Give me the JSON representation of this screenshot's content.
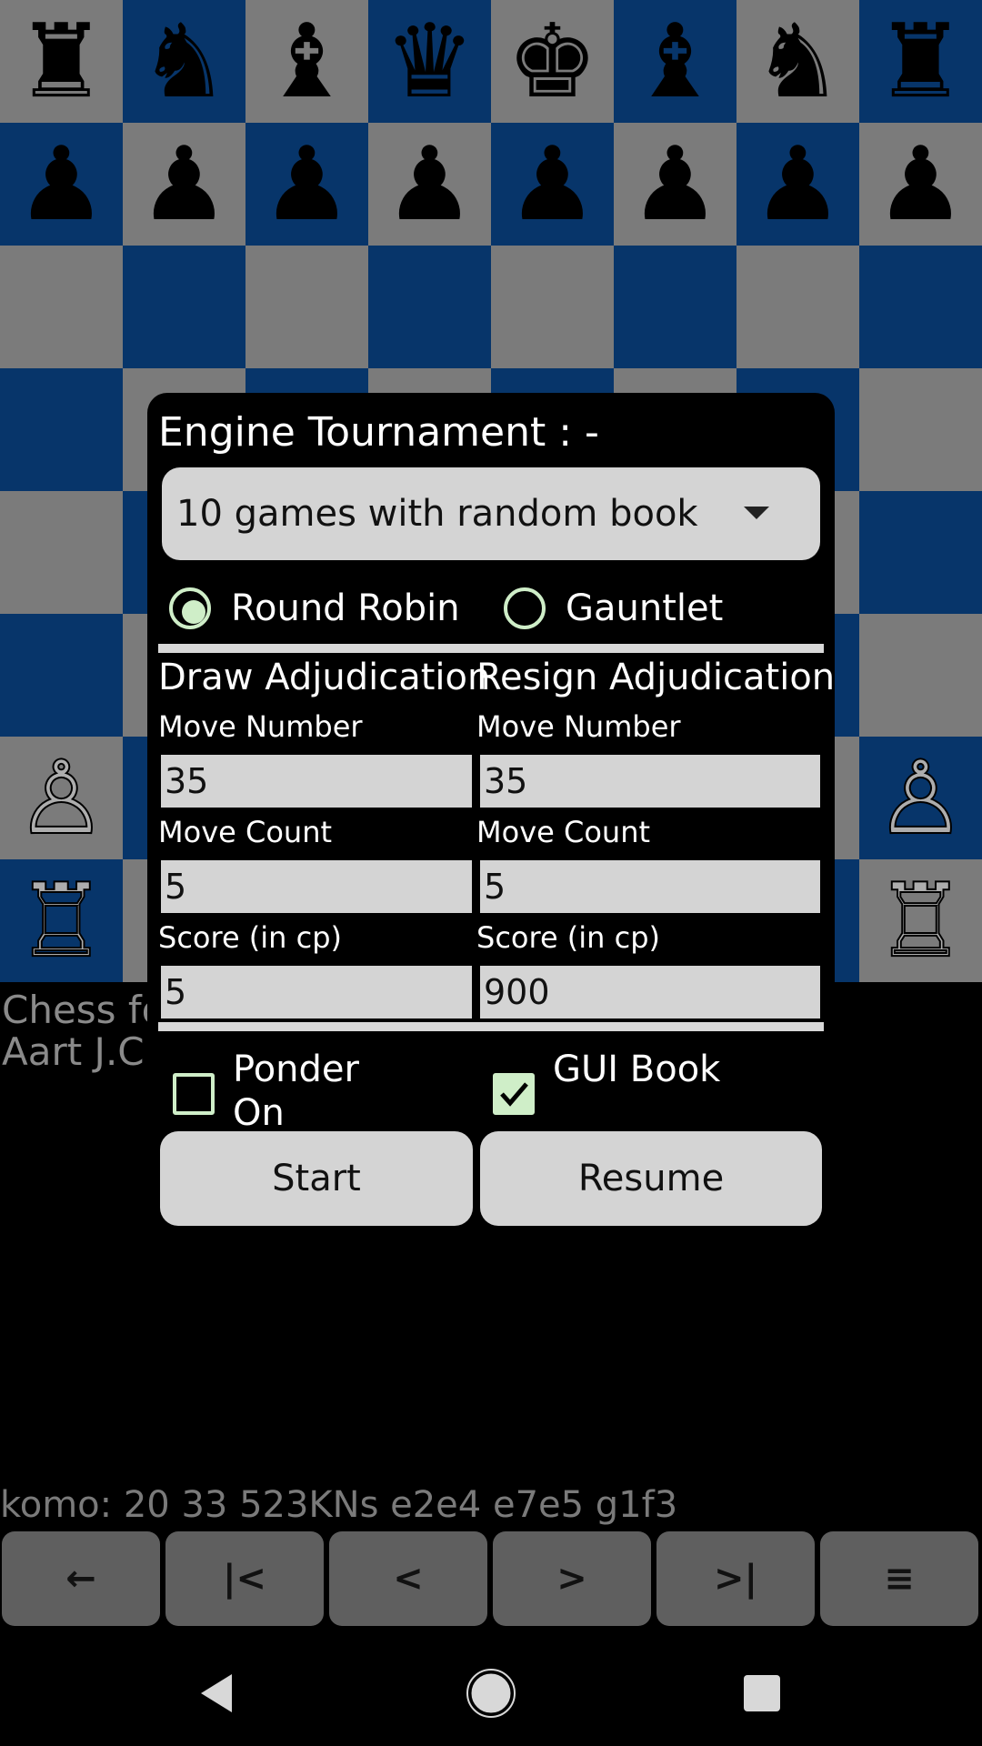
{
  "board": {
    "ranks": [
      [
        {
          "p": "♜",
          "c": "b"
        },
        {
          "p": "♞",
          "c": "b"
        },
        {
          "p": "♝",
          "c": "b"
        },
        {
          "p": "♛",
          "c": "b"
        },
        {
          "p": "♚",
          "c": "b"
        },
        {
          "p": "♝",
          "c": "b"
        },
        {
          "p": "♞",
          "c": "b"
        },
        {
          "p": "♜",
          "c": "b"
        }
      ],
      [
        {
          "p": "♟",
          "c": "b"
        },
        {
          "p": "♟",
          "c": "b"
        },
        {
          "p": "♟",
          "c": "b"
        },
        {
          "p": "♟",
          "c": "b"
        },
        {
          "p": "♟",
          "c": "b"
        },
        {
          "p": "♟",
          "c": "b"
        },
        {
          "p": "♟",
          "c": "b"
        },
        {
          "p": "♟",
          "c": "b"
        }
      ],
      [
        {},
        {},
        {},
        {},
        {},
        {},
        {},
        {}
      ],
      [
        {},
        {},
        {},
        {},
        {},
        {},
        {},
        {}
      ],
      [
        {},
        {},
        {},
        {},
        {},
        {},
        {},
        {}
      ],
      [
        {},
        {},
        {},
        {},
        {},
        {},
        {},
        {}
      ],
      [
        {
          "p": "♙",
          "c": "w"
        },
        {},
        {},
        {},
        {},
        {},
        {},
        {
          "p": "♙",
          "c": "w"
        }
      ],
      [
        {
          "p": "♖",
          "c": "w"
        },
        {},
        {},
        {},
        {},
        {},
        {},
        {
          "p": "♖",
          "c": "w"
        }
      ]
    ],
    "light_color": "#b5b5b5",
    "dark_color": "#0b4f9c"
  },
  "info": {
    "line1": "Chess fo",
    "line2": "Aart J.C"
  },
  "status_line": "komo: 20  33  523KNs  e2e4 e7e5 g1f3",
  "nav_buttons": [
    {
      "name": "back-icon",
      "glyph": "←"
    },
    {
      "name": "first-move-icon",
      "glyph": "|<"
    },
    {
      "name": "prev-move-icon",
      "glyph": "<"
    },
    {
      "name": "next-move-icon",
      "glyph": ">"
    },
    {
      "name": "last-move-icon",
      "glyph": ">|"
    },
    {
      "name": "menu-icon",
      "glyph": "≡"
    }
  ],
  "dialog": {
    "title": "Engine Tournament : -",
    "select_value": "10 games with random book",
    "radio_round_robin": "Round Robin",
    "radio_gauntlet": "Gauntlet",
    "selected_mode": "Round Robin",
    "draw_heading": "Draw Adjudication",
    "resign_heading": "Resign Adjudication",
    "draw": {
      "move_number_label": "Move Number",
      "move_number": "35",
      "move_count_label": "Move Count",
      "move_count": "5",
      "score_label": "Score (in cp)",
      "score": "5"
    },
    "resign": {
      "move_number_label": "Move Number",
      "move_number": "35",
      "move_count_label": "Move Count",
      "move_count": "5",
      "score_label": "Score (in cp)",
      "score": "900"
    },
    "ponder_label": "Ponder On",
    "ponder_checked": false,
    "gui_book_label": "GUI Book",
    "gui_book_checked": true,
    "start_label": "Start",
    "resume_label": "Resume"
  },
  "colors": {
    "accent": "#cfeec8",
    "field_bg": "#d4d4d4"
  }
}
